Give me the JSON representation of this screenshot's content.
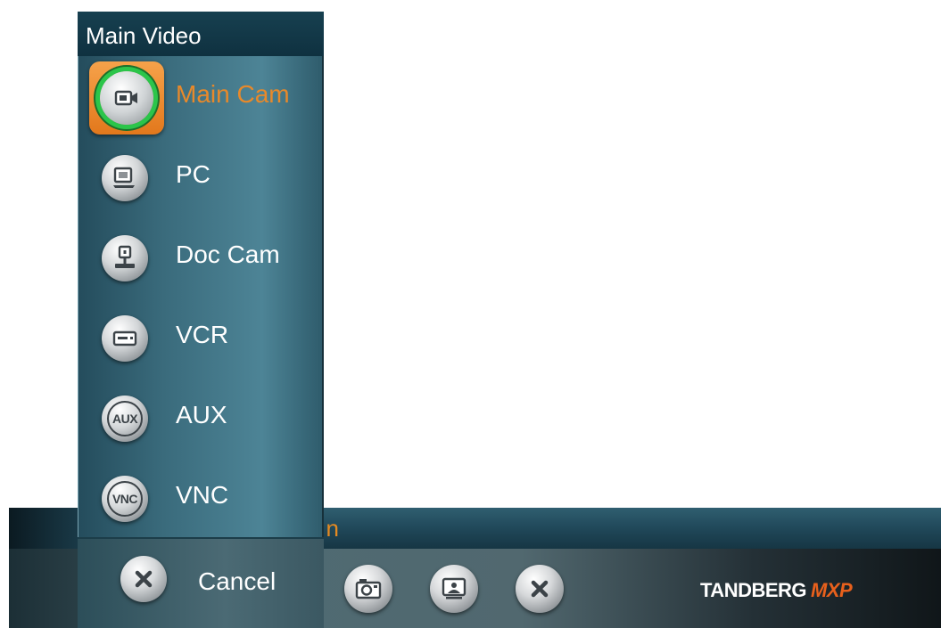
{
  "menu": {
    "title": "Main Video",
    "items": [
      {
        "label": "Main Cam",
        "icon": "video-camera-icon",
        "selected": true
      },
      {
        "label": "PC",
        "icon": "pc-monitor-icon",
        "selected": false
      },
      {
        "label": "Doc Cam",
        "icon": "document-camera-icon",
        "selected": false
      },
      {
        "label": "VCR",
        "icon": "vcr-icon",
        "selected": false
      },
      {
        "label": "AUX",
        "icon": "aux-icon",
        "icon_text": "AUX",
        "selected": false
      },
      {
        "label": "VNC",
        "icon": "vnc-icon",
        "icon_text": "VNC",
        "selected": false
      }
    ],
    "cancel_label": "Cancel"
  },
  "status_bar": {
    "text": "n"
  },
  "toolbar": {
    "buttons": [
      {
        "icon": "snapshot-camera-icon"
      },
      {
        "icon": "presentation-icon"
      },
      {
        "icon": "close-icon"
      }
    ],
    "brand": "TANDBERG",
    "brand_suffix": "MXP"
  },
  "colors": {
    "selected_text": "#e8892a",
    "selected_highlight": "#f08c2c",
    "active_ring": "#2bc54a",
    "brand_accent": "#e8601c",
    "panel_teal": "#3a6b7c"
  }
}
